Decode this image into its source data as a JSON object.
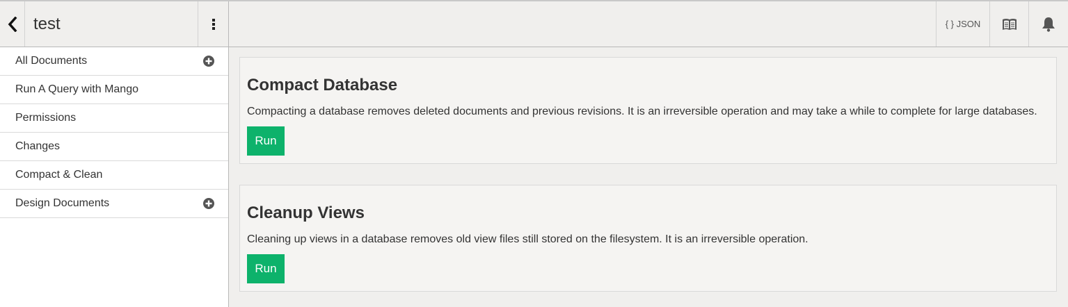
{
  "header": {
    "db_name": "test",
    "json_label": "{ } JSON"
  },
  "sidebar": {
    "items": [
      {
        "label": "All Documents",
        "has_add": true
      },
      {
        "label": "Run A Query with Mango",
        "has_add": false
      },
      {
        "label": "Permissions",
        "has_add": false
      },
      {
        "label": "Changes",
        "has_add": false
      },
      {
        "label": "Compact & Clean",
        "has_add": false
      },
      {
        "label": "Design Documents",
        "has_add": true
      }
    ]
  },
  "main": {
    "compact": {
      "title": "Compact Database",
      "description": "Compacting a database removes deleted documents and previous revisions. It is an irreversible operation and may take a while to complete for large databases.",
      "run_label": "Run"
    },
    "cleanup": {
      "title": "Cleanup Views",
      "description": "Cleaning up views in a database removes old view files still stored on the filesystem. It is an irreversible operation.",
      "run_label": "Run"
    }
  },
  "icons": {
    "back": "chevron-left-icon",
    "menu": "kebab-menu-icon",
    "docs": "book-icon",
    "notifications": "bell-icon",
    "add": "plus-circle-icon"
  },
  "colors": {
    "run_button": "#0db26b",
    "header_bg": "#f0efed",
    "sidebar_bg": "#ffffff"
  }
}
